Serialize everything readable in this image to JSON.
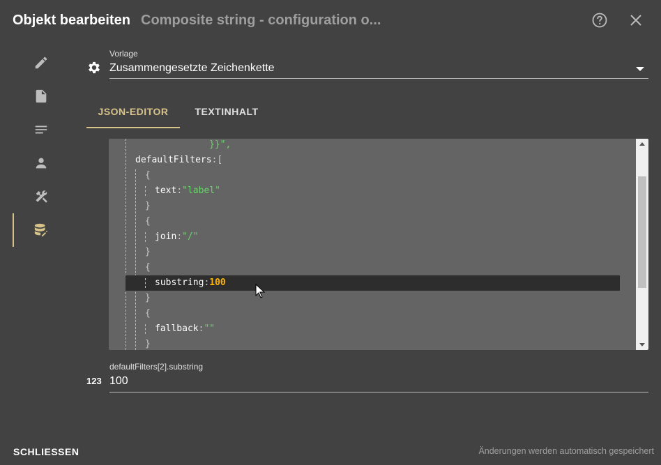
{
  "header": {
    "title": "Objekt bearbeiten",
    "subtitle": "Composite string - configuration o...",
    "help_icon": "help-circle-icon",
    "close_icon": "close-icon"
  },
  "sidebar": {
    "items": [
      {
        "icon": "pencil-icon"
      },
      {
        "icon": "file-icon"
      },
      {
        "icon": "text-lines-icon"
      },
      {
        "icon": "user-icon"
      },
      {
        "icon": "tools-icon"
      },
      {
        "icon": "database-edit-icon",
        "active": true
      }
    ]
  },
  "template": {
    "label": "Vorlage",
    "value": "Zusammengesetzte Zeichenkette"
  },
  "tabs": [
    {
      "label": "JSON-EDITOR",
      "active": true
    },
    {
      "label": "TEXTINHALT",
      "active": false
    }
  ],
  "editor": {
    "lines": [
      {
        "indent": 0,
        "key": "",
        "value": "}}\",",
        "value_type": "string"
      },
      {
        "indent": 0,
        "key": "defaultFilters",
        "value": "[",
        "value_type": "punct"
      },
      {
        "indent": 1,
        "key": "",
        "value": "{",
        "value_type": "punct"
      },
      {
        "indent": 2,
        "key": "text",
        "value": "\"label\"",
        "value_type": "string"
      },
      {
        "indent": 1,
        "key": "",
        "value": "}",
        "value_type": "punct"
      },
      {
        "indent": 1,
        "key": "",
        "value": "{",
        "value_type": "punct"
      },
      {
        "indent": 2,
        "key": "join",
        "value": "\"/\"",
        "value_type": "string"
      },
      {
        "indent": 1,
        "key": "",
        "value": "}",
        "value_type": "punct"
      },
      {
        "indent": 1,
        "key": "",
        "value": "{",
        "value_type": "punct"
      },
      {
        "indent": 2,
        "key": "substring",
        "value": "100",
        "value_type": "number",
        "highlight": true
      },
      {
        "indent": 1,
        "key": "",
        "value": "}",
        "value_type": "punct"
      },
      {
        "indent": 1,
        "key": "",
        "value": "{",
        "value_type": "punct"
      },
      {
        "indent": 2,
        "key": "fallback",
        "value": "\"\"",
        "value_type": "string"
      },
      {
        "indent": 1,
        "key": "",
        "value": "}",
        "value_type": "punct"
      }
    ]
  },
  "field": {
    "icon_text": "123",
    "label": "defaultFilters[2].substring",
    "value": "100"
  },
  "footer": {
    "close_label": "SCHLIESSEN",
    "status": "Änderungen werden automatisch gespeichert"
  },
  "colors": {
    "background": "#424242",
    "accent": "#d8c48a",
    "editor_bg": "#646464",
    "string": "#6bd36b",
    "number": "#ffb300"
  }
}
